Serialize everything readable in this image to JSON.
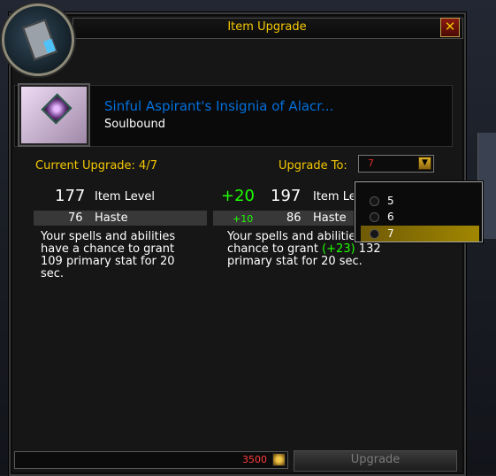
{
  "window": {
    "title": "Item Upgrade",
    "close_icon": "close-x"
  },
  "item": {
    "name": "Sinful Aspirant's Insignia of Alacr...",
    "binding": "Soulbound",
    "name_color": "#0070dd",
    "icon": "insignia-icon"
  },
  "upgrade": {
    "current_label": "Current Upgrade: 4/7",
    "target_label": "Upgrade To:",
    "selected": "7",
    "options": [
      {
        "label": "5",
        "selected": false
      },
      {
        "label": "6",
        "selected": false
      },
      {
        "label": "7",
        "selected": true
      }
    ]
  },
  "current": {
    "item_level": "177",
    "item_level_label": "Item Level",
    "haste_value": "76",
    "haste_label": "Haste",
    "effect_lines": [
      "Your spells and abilities",
      "have a chance to grant",
      "109 primary stat for 20",
      "sec."
    ]
  },
  "upgraded": {
    "item_level_delta": "+20",
    "item_level": "197",
    "item_level_label": "Item Level",
    "haste_delta": "+10",
    "haste_value": "86",
    "haste_label": "Haste",
    "effect_line1": "Your spells and abilities have a",
    "effect_line2_pre": "chance to grant ",
    "effect_line2_green": "(+23)",
    "effect_line2_post": " 132",
    "effect_line3": "primary stat for 20 sec."
  },
  "footer": {
    "cost": "3500",
    "cost_icon": "valor-currency-icon",
    "button_label": "Upgrade"
  },
  "colors": {
    "gold": "#f5c800",
    "green": "#1eff00",
    "red": "#dd2b2b"
  }
}
